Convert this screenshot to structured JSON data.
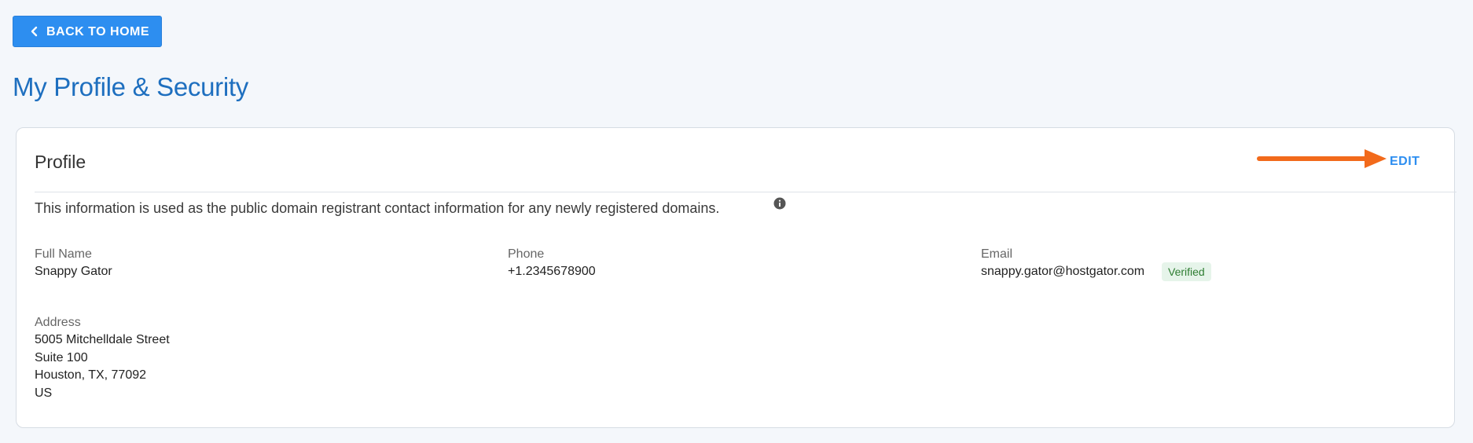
{
  "nav": {
    "back_label": "BACK TO HOME"
  },
  "page": {
    "title": "My Profile & Security"
  },
  "profile": {
    "title": "Profile",
    "edit_label": "EDIT",
    "info_text": "This information is used as the public domain registrant contact information for any newly registered domains.",
    "fields": {
      "full_name": {
        "label": "Full Name",
        "value": "Snappy Gator"
      },
      "phone": {
        "label": "Phone",
        "value": "+1.2345678900"
      },
      "email": {
        "label": "Email",
        "value": "snappy.gator@hostgator.com",
        "badge": "Verified"
      },
      "address": {
        "label": "Address",
        "lines": [
          "5005 Mitchelldale Street",
          "Suite 100",
          "Houston, TX, 77092",
          "US"
        ]
      }
    }
  },
  "colors": {
    "primary": "#2d8ef0",
    "title_blue": "#1e6fbf",
    "annotation_arrow": "#f26a1b",
    "verified_bg": "#e6f4ea",
    "verified_text": "#2e7d32"
  },
  "icons": {
    "back": "chevron-left-icon",
    "info": "info-icon",
    "annotation": "arrow-right-icon"
  }
}
